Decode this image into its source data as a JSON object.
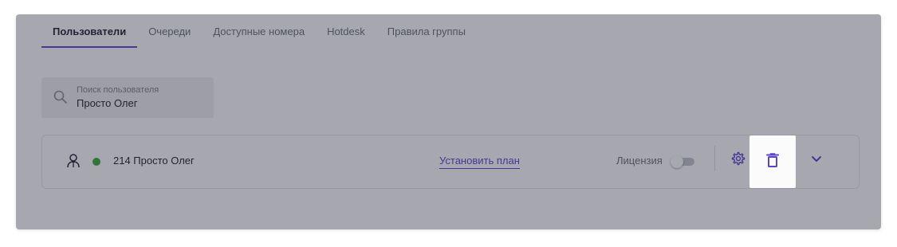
{
  "tabs": [
    {
      "label": "Пользователи",
      "active": true
    },
    {
      "label": "Очереди",
      "active": false
    },
    {
      "label": "Доступные номера",
      "active": false
    },
    {
      "label": "Hotdesk",
      "active": false
    },
    {
      "label": "Правила группы",
      "active": false
    }
  ],
  "search": {
    "label": "Поиск пользователя",
    "value": "Просто Олег"
  },
  "user": {
    "name": "214 Просто Олег",
    "status_color": "#3bab3a",
    "set_plan_label": "Установить план",
    "license_label": "Лицензия",
    "license_enabled": false
  },
  "icons": {
    "search": "search-icon",
    "user": "user-icon",
    "settings": "gear-icon",
    "delete": "trash-icon",
    "expand": "chevron-down-icon"
  },
  "colors": {
    "accent": "#5a43d6",
    "status_online": "#3bab3a",
    "modal_overlay": "rgba(35, 38, 55, 0.40)"
  }
}
